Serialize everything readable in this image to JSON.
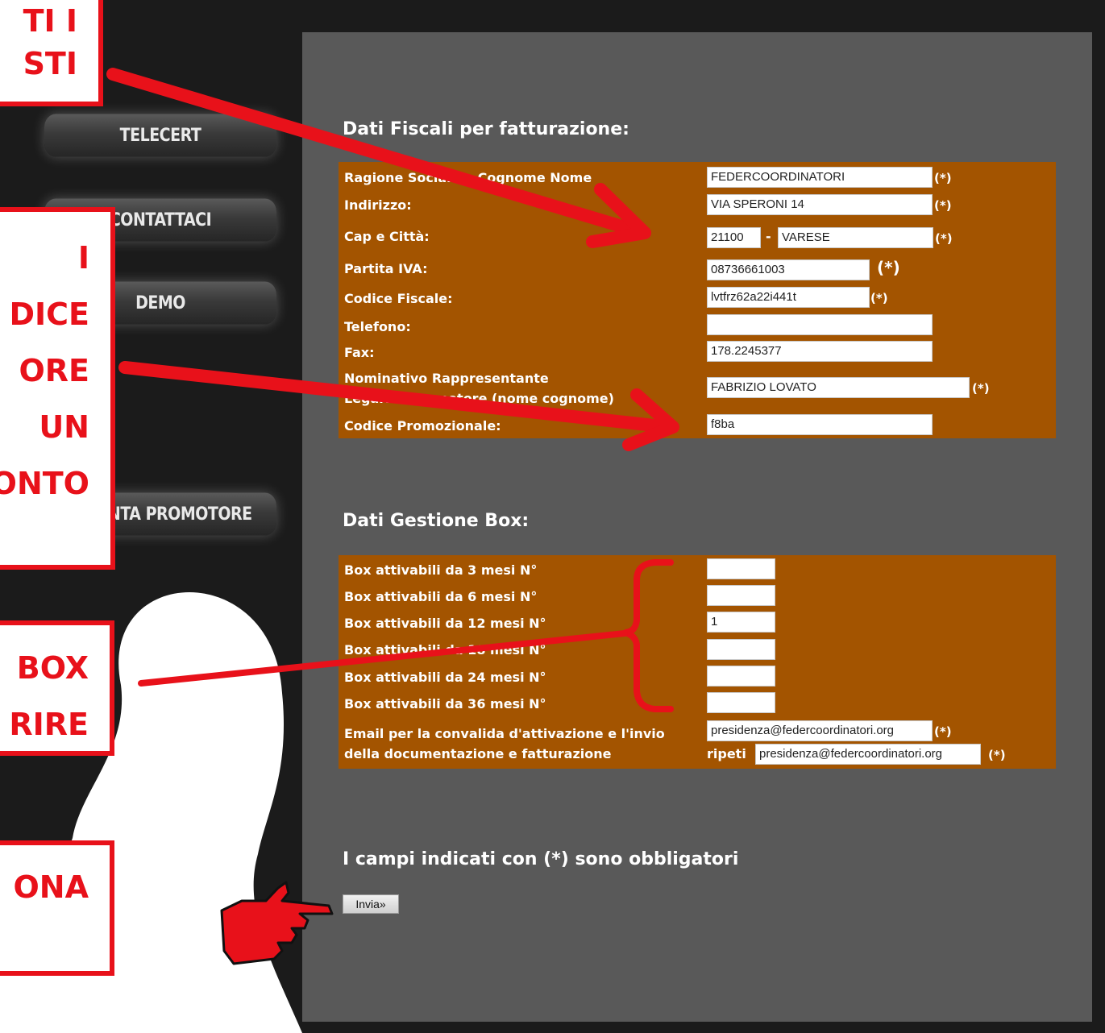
{
  "sidebar": {
    "items": [
      "TELECERT",
      "CONTATTACI",
      "DEMO",
      "DIVENTA PROMOTORE"
    ]
  },
  "fiscal": {
    "title": "Dati Fiscali per fatturazione:",
    "rows": [
      {
        "label": "Ragione Sociale o Cognome Nome",
        "value": "FEDERCOORDINATORI"
      },
      {
        "label": "Indirizzo:",
        "value": "VIA SPERONI 14"
      },
      {
        "label": "Cap e Città:",
        "cap": "21100",
        "city": "VARESE",
        "dash": "-"
      },
      {
        "label": "Partita IVA:",
        "value": "08736661003"
      },
      {
        "label": "Codice Fiscale:",
        "value": "lvtfrz62a22i441t"
      },
      {
        "label": "Telefono:",
        "value": ""
      },
      {
        "label": "Fax:",
        "value": "178.2245377"
      },
      {
        "label_line1": "Nominativo Rappresentante",
        "label_line2": "Legale o Promotore (nome cognome)",
        "value": "FABRIZIO LOVATO"
      },
      {
        "label": "Codice Promozionale:",
        "value": "f8ba"
      }
    ],
    "required": "(*)"
  },
  "box": {
    "title": "Dati Gestione Box:",
    "rows": [
      {
        "label": "Box attivabili da 3 mesi N°",
        "value": ""
      },
      {
        "label": "Box attivabili da 6 mesi N°",
        "value": ""
      },
      {
        "label": "Box attivabili da 12 mesi N°",
        "value": "1"
      },
      {
        "label": "Box attivabili da 18 mesi N°",
        "value": ""
      },
      {
        "label": "Box attivabili da 24 mesi N°",
        "value": ""
      },
      {
        "label": "Box attivabili da 36 mesi N°",
        "value": ""
      }
    ],
    "email_label_line1": "Email per la convalida d'attivazione e l'invio",
    "email_label_line2": "della documentazione e fatturazione",
    "email": "presidenza@federcoordinatori.org",
    "repeat_label": "ripeti",
    "email_repeat": "presidenza@federcoordinatori.org"
  },
  "footer": {
    "mandatory_note": "I campi indicati con (*) sono obbligatori",
    "submit_label": "Invia»"
  },
  "callouts": [
    {
      "lines": [
        "TUTTI I",
        "CAMPI RICHIESTI"
      ],
      "visible": [
        "TI I",
        "STI"
      ]
    },
    {
      "visible": [
        "I",
        "DICE",
        "ORE",
        "UN",
        "ONTO"
      ]
    },
    {
      "visible": [
        "BOX",
        "RIRE"
      ]
    },
    {
      "visible": [
        "ONA"
      ]
    }
  ],
  "colors": {
    "annotation_red": "#e8111a",
    "form_box": "#a35400",
    "panel": "#595959",
    "frame": "#1b1b1b"
  }
}
